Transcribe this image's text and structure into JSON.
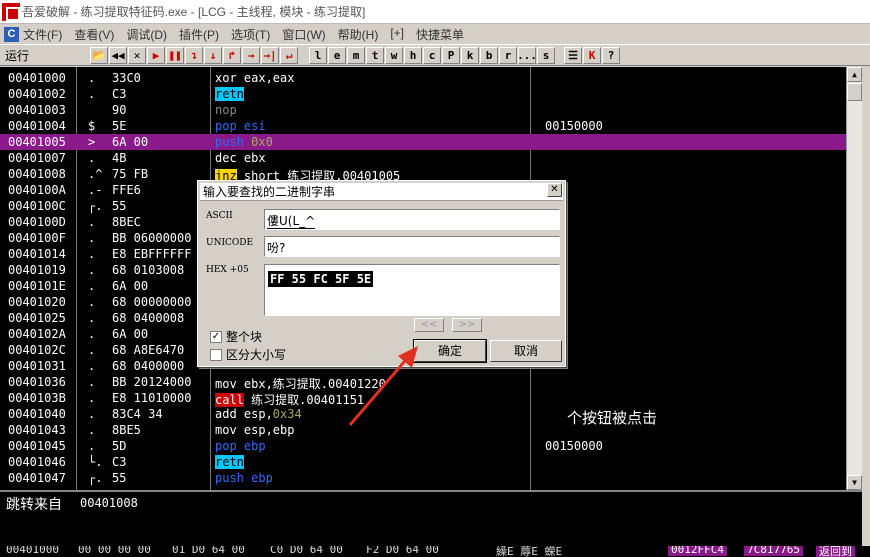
{
  "window": {
    "title": "吾爱破解 - 练习提取特征码.exe - [LCG - 主线程, 模块 - 练习提取]"
  },
  "menu": {
    "items": [
      "文件(F)",
      "查看(V)",
      "调试(D)",
      "插件(P)",
      "选项(T)",
      "窗口(W)",
      "帮助(H)",
      "[+]",
      "快捷菜单"
    ]
  },
  "toolbar": {
    "status": "运行",
    "left_buttons": [
      "📂",
      "◀◀",
      "✕",
      "▶",
      "❚❚",
      "↴",
      "↓",
      "↱",
      "→",
      "→|",
      "↵"
    ],
    "letter_buttons": [
      "l",
      "e",
      "m",
      "t",
      "w",
      "h",
      "c",
      "P",
      "k",
      "b",
      "r",
      "...",
      "s"
    ],
    "right_buttons": [
      "☰",
      "K",
      "?"
    ]
  },
  "disasm": {
    "rows": [
      {
        "addr": "00401000",
        "mark": ".",
        "hex": "33C0",
        "asm": [
          {
            "t": "xor eax,eax",
            "c": ""
          }
        ],
        "val": ""
      },
      {
        "addr": "00401002",
        "mark": ".",
        "hex": "C3",
        "asm": [
          {
            "t": "retn",
            "c": "k-cyan"
          }
        ],
        "val": ""
      },
      {
        "addr": "00401003",
        "mark": "",
        "hex": "90",
        "asm": [
          {
            "t": "nop",
            "c": "k-dim"
          }
        ],
        "val": ""
      },
      {
        "addr": "00401004",
        "mark": "$",
        "hex": "5E",
        "asm": [
          {
            "t": "pop esi",
            "c": "k-blue"
          }
        ],
        "val": "00150000"
      },
      {
        "addr": "00401005",
        "mark": ">",
        "hex": "6A 00",
        "asm": [
          {
            "t": "push ",
            "c": "k-blue"
          },
          {
            "t": "0x0",
            "c": "k-num"
          }
        ],
        "val": "",
        "hl": true
      },
      {
        "addr": "00401007",
        "mark": ".",
        "hex": "4B",
        "asm": [
          {
            "t": "dec ebx",
            "c": ""
          }
        ],
        "val": ""
      },
      {
        "addr": "00401008",
        "mark": ".^",
        "hex": "75 FB",
        "asm": [
          {
            "t": "jnz",
            "c": "k-jnz"
          },
          {
            "t": " short 练习提取.00401005",
            "c": ""
          }
        ],
        "val": ""
      },
      {
        "addr": "0040100A",
        "mark": ".-",
        "hex": "FFE6",
        "asm": [],
        "val": ""
      },
      {
        "addr": "0040100C",
        "mark": "┌.",
        "hex": "55",
        "asm": [],
        "val": ""
      },
      {
        "addr": "0040100D",
        "mark": ".",
        "hex": "8BEC",
        "asm": [],
        "val": ""
      },
      {
        "addr": "0040100F",
        "mark": ".",
        "hex": "BB 06000000",
        "asm": [],
        "val": ""
      },
      {
        "addr": "00401014",
        "mark": ".",
        "hex": "E8 EBFFFFFF",
        "asm": [],
        "val": ""
      },
      {
        "addr": "00401019",
        "mark": ".",
        "hex": "68 0103008",
        "asm": [],
        "val": ""
      },
      {
        "addr": "0040101E",
        "mark": ".",
        "hex": "6A 00",
        "asm": [],
        "val": ""
      },
      {
        "addr": "00401020",
        "mark": ".",
        "hex": "68 00000000",
        "asm": [],
        "val": ""
      },
      {
        "addr": "00401025",
        "mark": ".",
        "hex": "68 0400008",
        "asm": [],
        "val": ""
      },
      {
        "addr": "0040102A",
        "mark": ".",
        "hex": "6A 00",
        "asm": [],
        "val": ""
      },
      {
        "addr": "0040102C",
        "mark": ".",
        "hex": "68 A8E6470",
        "asm": [],
        "val": ""
      },
      {
        "addr": "00401031",
        "mark": ".",
        "hex": "68 0400000",
        "asm": [],
        "val": ""
      },
      {
        "addr": "00401036",
        "mark": ".",
        "hex": "BB 20124000",
        "asm": [
          {
            "t": "mov ebx,练习提取.00401220",
            "c": ""
          }
        ],
        "val": ""
      },
      {
        "addr": "0040103B",
        "mark": ".",
        "hex": "E8 11010000",
        "asm": [
          {
            "t": "call",
            "c": "k-call"
          },
          {
            "t": " 练习提取.00401151",
            "c": ""
          }
        ],
        "val": ""
      },
      {
        "addr": "00401040",
        "mark": ".",
        "hex": "83C4 34",
        "asm": [
          {
            "t": "add esp,",
            "c": ""
          },
          {
            "t": "0x34",
            "c": "k-num"
          }
        ],
        "val": ""
      },
      {
        "addr": "00401043",
        "mark": ".",
        "hex": "8BE5",
        "asm": [
          {
            "t": "mov esp,ebp",
            "c": ""
          }
        ],
        "val": ""
      },
      {
        "addr": "00401045",
        "mark": ".",
        "hex": "5D",
        "asm": [
          {
            "t": "pop ebp",
            "c": "k-blue"
          }
        ],
        "val": "00150000"
      },
      {
        "addr": "00401046",
        "mark": "└.",
        "hex": "C3",
        "asm": [
          {
            "t": "retn",
            "c": "k-cyan"
          }
        ],
        "val": ""
      },
      {
        "addr": "00401047",
        "mark": "┌.",
        "hex": "55",
        "asm": [
          {
            "t": "push ebp",
            "c": "k-blue"
          }
        ],
        "val": ""
      }
    ]
  },
  "info": {
    "text": "跳转来自",
    "addr": "00401008"
  },
  "dump_strip": {
    "parts": [
      "00401000",
      "00 00 00 00",
      "01 D0 64 00",
      "C0 D0 64 00",
      "F2 D0 64 00",
      "繰E 蓐E 蝾E",
      "0012FFC4",
      "7C817765",
      "返回到"
    ]
  },
  "tail_text": "个按钮被点击",
  "dialog": {
    "title": "输入要查找的二进制字串",
    "close": "✕",
    "ascii_label": "ASCII",
    "ascii_value": "僂U(L_^",
    "unicode_label": "UNICODE",
    "unicode_value": "吩?",
    "hex_label": "HEX +05",
    "hex_value": "FF 55 FC 5F 5E",
    "prev": "<<",
    "next": ">>",
    "check_block": "整个块",
    "check_block_checked": "✓",
    "check_case": "区分大小写",
    "ok": "确定",
    "cancel": "取消"
  },
  "colors": {
    "highlight_row": "#8a1a8a",
    "arrow": "#e03020"
  }
}
